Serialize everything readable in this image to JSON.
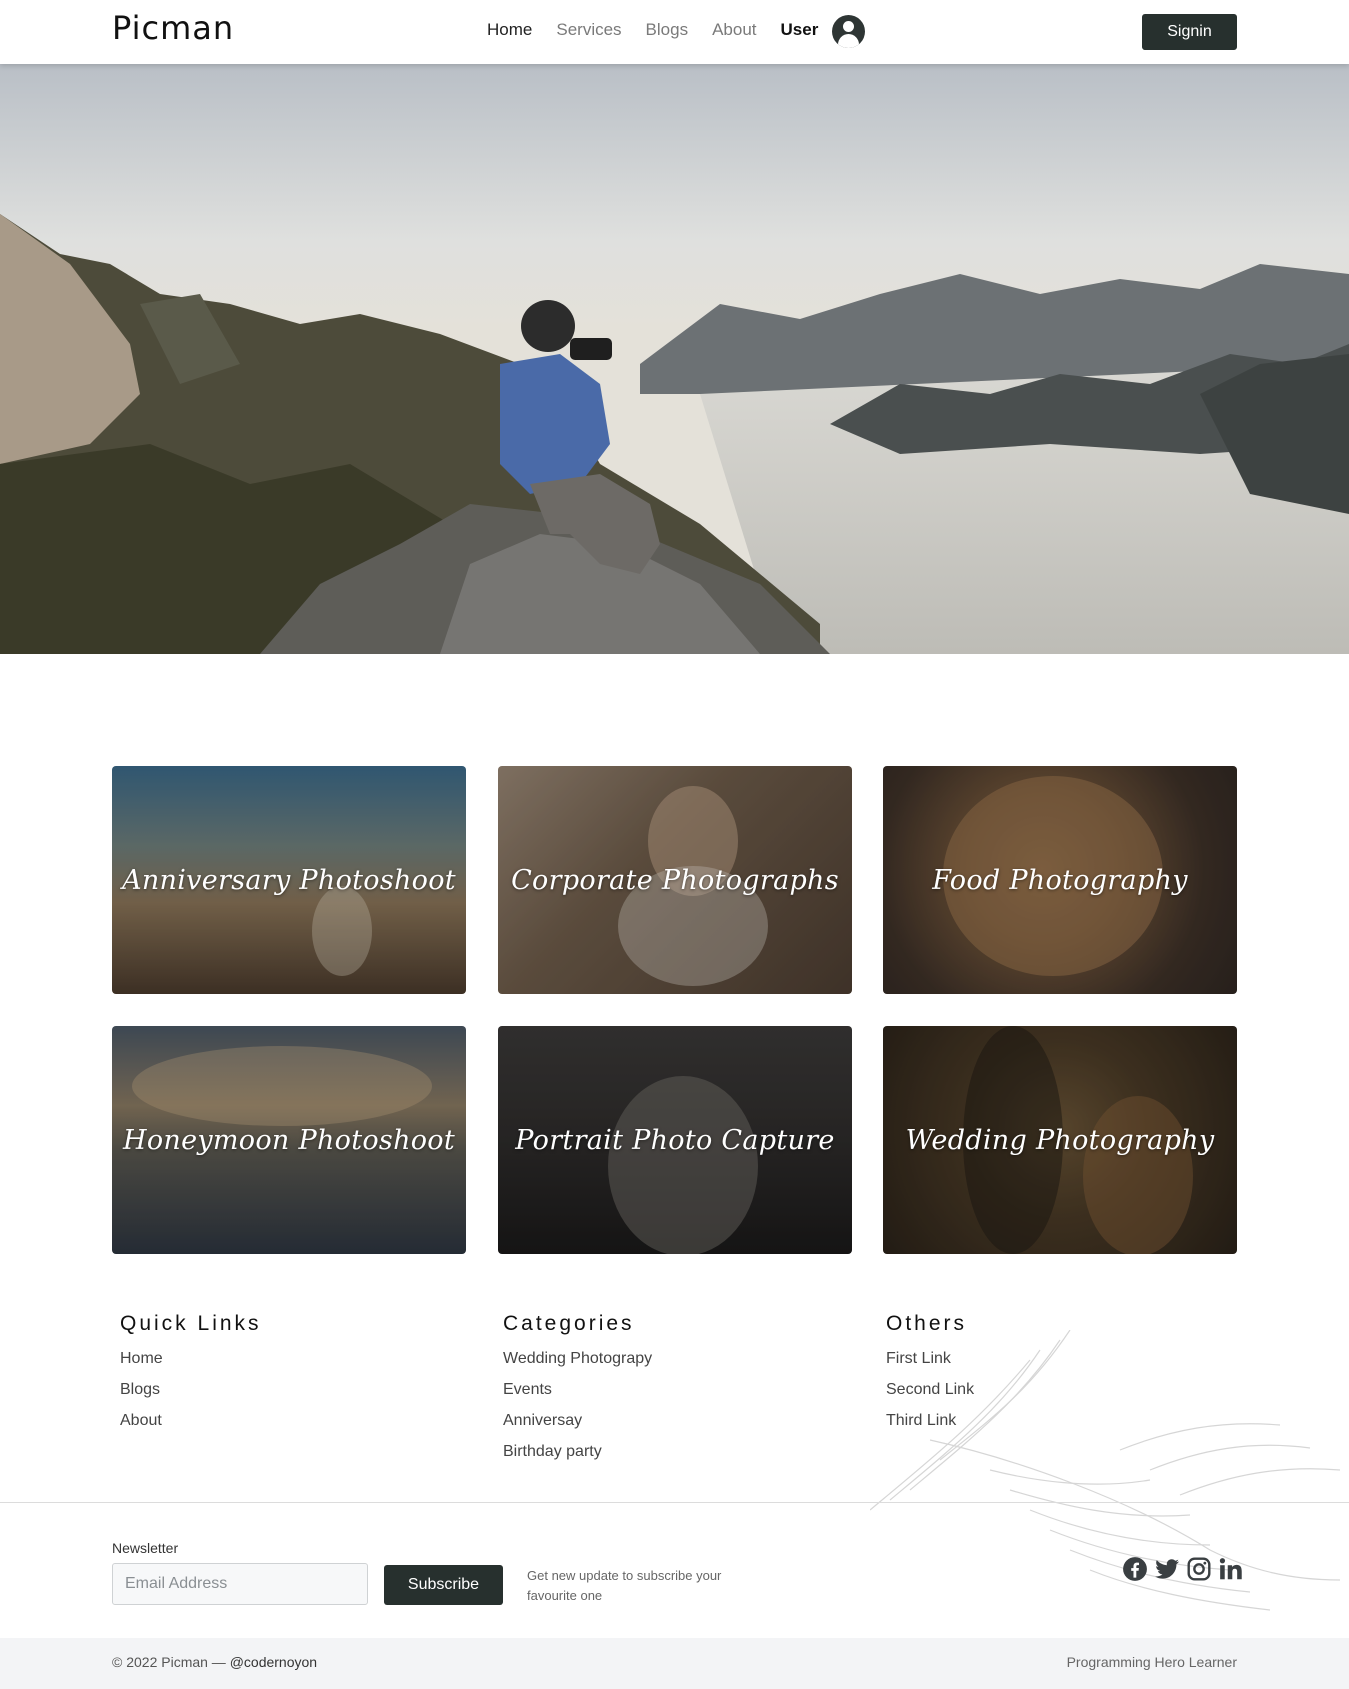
{
  "brand": "Picman",
  "nav": {
    "items": [
      {
        "label": "Home"
      },
      {
        "label": "Services"
      },
      {
        "label": "Blogs"
      },
      {
        "label": "About"
      },
      {
        "label": "User"
      }
    ],
    "signin_label": "Signin"
  },
  "hero": {
    "icon": "photographer-mountain-image"
  },
  "cards": [
    {
      "title": "Anniversary Photoshoot"
    },
    {
      "title": "Corporate Photographs"
    },
    {
      "title": "Food Photography"
    },
    {
      "title": "Honeymoon Photoshoot"
    },
    {
      "title": "Portrait Photo Capture"
    },
    {
      "title": "Wedding Photography"
    }
  ],
  "footer": {
    "quick_links": {
      "heading": "Quick Links",
      "items": [
        "Home",
        "Blogs",
        "About"
      ]
    },
    "categories": {
      "heading": "Categories",
      "items": [
        "Wedding Photograpy",
        "Events",
        "Anniversay",
        "Birthday party"
      ]
    },
    "others": {
      "heading": "Others",
      "items": [
        "First Link",
        "Second Link",
        "Third Link"
      ]
    }
  },
  "newsletter": {
    "label": "Newsletter",
    "placeholder": "Email Address",
    "value": "",
    "button": "Subscribe",
    "note": "Get new update to subscribe your favourite one"
  },
  "socials": [
    "facebook-icon",
    "twitter-icon",
    "instagram-icon",
    "linkedin-icon"
  ],
  "bottom": {
    "copyright": "© 2022 Picman —",
    "handle": "@codernoyon",
    "right": "Programming Hero Learner"
  },
  "colors": {
    "dark_button": "#27302e",
    "bottom_bar": "#f3f4f6"
  }
}
